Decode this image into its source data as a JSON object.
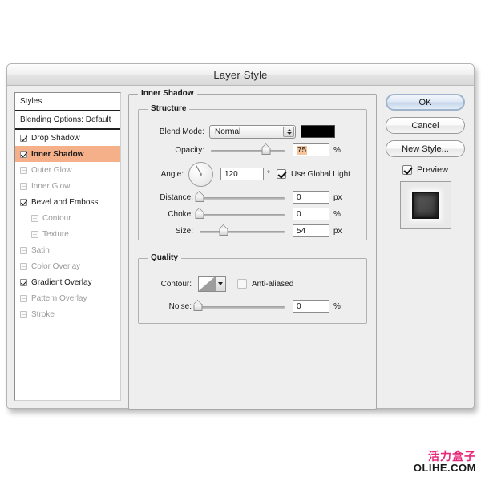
{
  "window": {
    "title": "Layer Style"
  },
  "styles_panel": {
    "header": "Styles",
    "blending_options": "Blending Options: Default",
    "effects": [
      {
        "label": "Drop Shadow",
        "checked": true,
        "selected": false,
        "sub": false,
        "enabled": true
      },
      {
        "label": "Inner Shadow",
        "checked": true,
        "selected": true,
        "sub": false,
        "enabled": true
      },
      {
        "label": "Outer Glow",
        "checked": false,
        "selected": false,
        "sub": false,
        "enabled": false
      },
      {
        "label": "Inner Glow",
        "checked": false,
        "selected": false,
        "sub": false,
        "enabled": false
      },
      {
        "label": "Bevel and Emboss",
        "checked": true,
        "selected": false,
        "sub": false,
        "enabled": true
      },
      {
        "label": "Contour",
        "checked": false,
        "selected": false,
        "sub": true,
        "enabled": false
      },
      {
        "label": "Texture",
        "checked": false,
        "selected": false,
        "sub": true,
        "enabled": false
      },
      {
        "label": "Satin",
        "checked": false,
        "selected": false,
        "sub": false,
        "enabled": false
      },
      {
        "label": "Color Overlay",
        "checked": false,
        "selected": false,
        "sub": false,
        "enabled": false
      },
      {
        "label": "Gradient Overlay",
        "checked": true,
        "selected": false,
        "sub": false,
        "enabled": true
      },
      {
        "label": "Pattern Overlay",
        "checked": false,
        "selected": false,
        "sub": false,
        "enabled": false
      },
      {
        "label": "Stroke",
        "checked": false,
        "selected": false,
        "sub": false,
        "enabled": false
      }
    ]
  },
  "panel": {
    "title": "Inner Shadow",
    "structure": {
      "title": "Structure",
      "blend_mode_label": "Blend Mode:",
      "blend_mode_value": "Normal",
      "color": "#000000",
      "opacity_label": "Opacity:",
      "opacity_value": "75",
      "opacity_unit": "%",
      "opacity_percent": 75,
      "angle_label": "Angle:",
      "angle_value": "120",
      "angle_unit": "°",
      "angle_degrees": 120,
      "use_global_light_label": "Use Global Light",
      "use_global_light_checked": true,
      "distance_label": "Distance:",
      "distance_value": "0",
      "distance_unit": "px",
      "distance_percent": 0,
      "choke_label": "Choke:",
      "choke_value": "0",
      "choke_unit": "%",
      "choke_percent": 0,
      "size_label": "Size:",
      "size_value": "54",
      "size_unit": "px",
      "size_percent": 28
    },
    "quality": {
      "title": "Quality",
      "contour_label": "Contour:",
      "anti_aliased_label": "Anti-aliased",
      "anti_aliased_checked": false,
      "noise_label": "Noise:",
      "noise_value": "0",
      "noise_unit": "%",
      "noise_percent": 0
    }
  },
  "buttons": {
    "ok": "OK",
    "cancel": "Cancel",
    "new_style": "New Style...",
    "preview_label": "Preview",
    "preview_checked": true
  },
  "watermark": {
    "chinese": "活力盒子",
    "english": "OLIHE.COM",
    "chinese_color": "#e8297a"
  }
}
